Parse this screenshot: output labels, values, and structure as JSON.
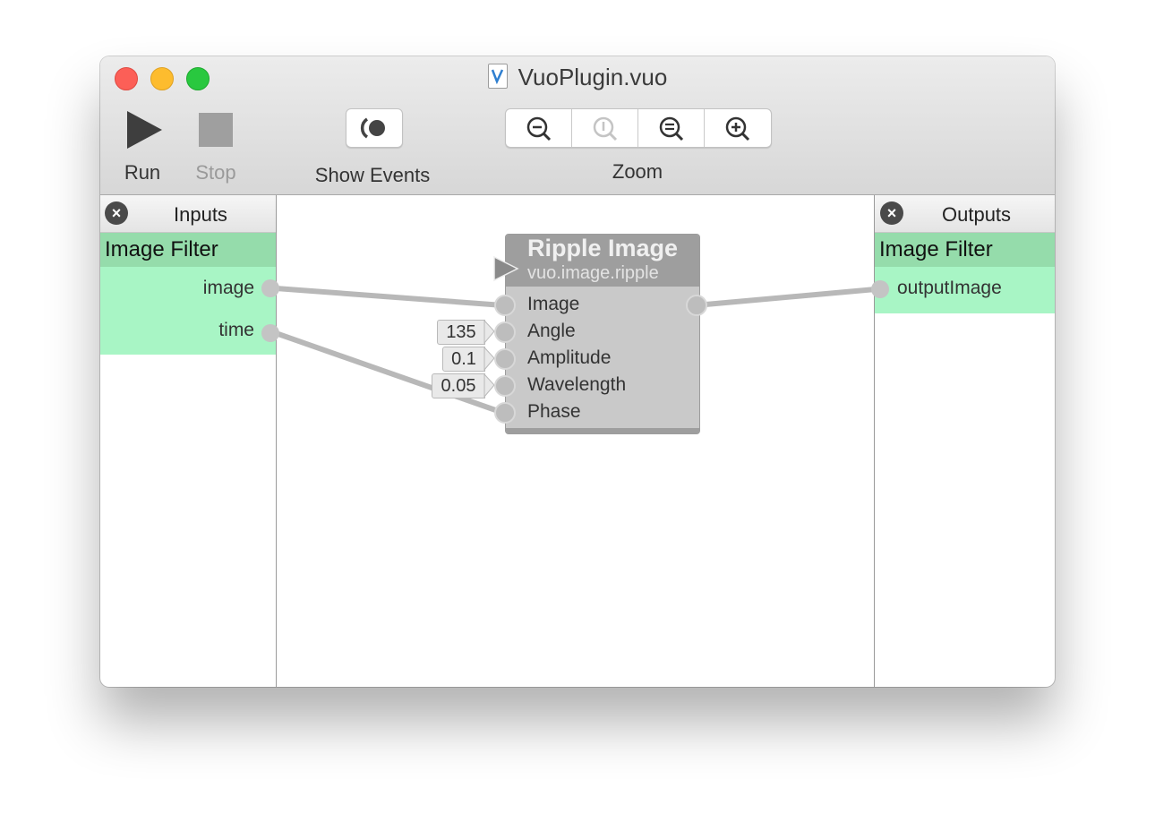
{
  "window": {
    "title": "VuoPlugin.vuo"
  },
  "toolbar": {
    "run_label": "Run",
    "stop_label": "Stop",
    "show_events_label": "Show Events",
    "zoom_label": "Zoom",
    "zoom_buttons": [
      "zoom-out-icon",
      "zoom-actual-size-icon",
      "zoom-to-fit-icon",
      "zoom-in-icon"
    ]
  },
  "inputs_panel": {
    "header": "Inputs",
    "group_title": "Image Filter",
    "ports": [
      "image",
      "time"
    ]
  },
  "outputs_panel": {
    "header": "Outputs",
    "group_title": "Image Filter",
    "ports": [
      "outputImage"
    ]
  },
  "node": {
    "title": "Ripple Image",
    "class_name": "vuo.image.ripple",
    "ports": [
      "Image",
      "Angle",
      "Amplitude",
      "Wavelength",
      "Phase"
    ],
    "constants": {
      "angle": "135",
      "amplitude": "0.1",
      "wavelength": "0.05"
    }
  },
  "colors": {
    "published_port_bg": "#a8f5c5",
    "group_title_bg": "#95dcab",
    "node_body": "#c9c9c9",
    "node_header": "#9e9e9e",
    "cable": "#b8b8b8"
  }
}
